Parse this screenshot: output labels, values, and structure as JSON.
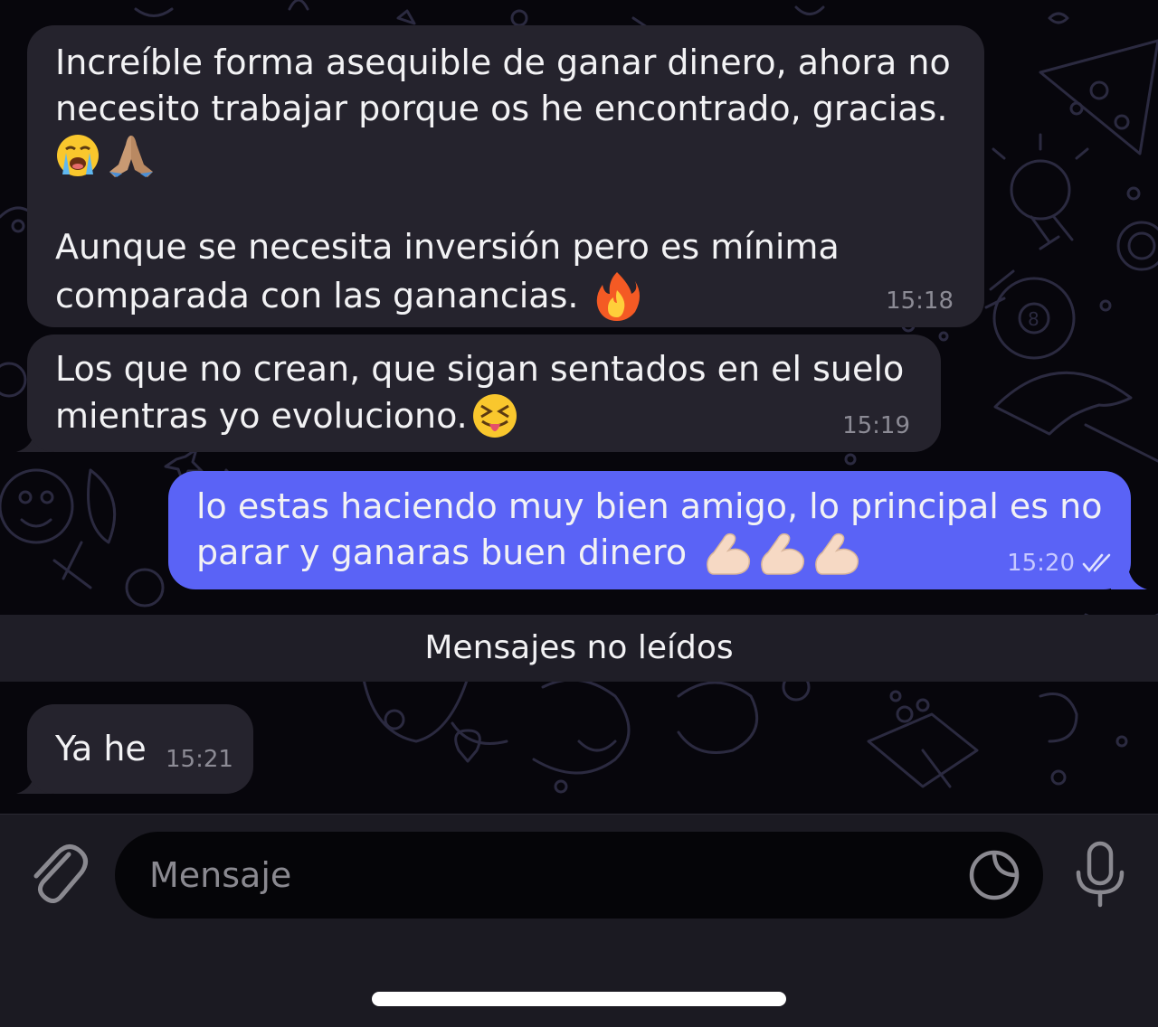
{
  "colors": {
    "background": "#07060c",
    "incoming_bubble": "#25232d",
    "outgoing_bubble": "#5a63f6",
    "input_bar": "#1b1a22",
    "unread_bar": "#1f1e27"
  },
  "messages": [
    {
      "direction": "incoming",
      "lines": [
        "Increíble forma asequible de ganar dinero, ahora no",
        "necesito trabajar porque os he encontrado, gracias."
      ],
      "emojis_1": [
        "loudly-crying-face-emoji",
        "folded-hands-emoji"
      ],
      "lines_2": [
        "Aunque se necesita inversión pero es mínima",
        "comparada con las ganancias."
      ],
      "emojis_2": [
        "fire-emoji"
      ],
      "time": "15:18"
    },
    {
      "direction": "incoming",
      "lines": [
        "Los que no crean, que sigan sentados en el suelo",
        "mientras yo evoluciono."
      ],
      "emojis": [
        "squinting-face-with-tongue-emoji"
      ],
      "time": "15:19"
    },
    {
      "direction": "outgoing",
      "lines": [
        "lo estas haciendo muy bien amigo, lo principal es no",
        "parar y ganaras buen dinero"
      ],
      "emojis": [
        "flexed-biceps-emoji",
        "flexed-biceps-emoji",
        "flexed-biceps-emoji"
      ],
      "time": "15:20",
      "status": "read-double-check-icon"
    },
    {
      "direction": "incoming",
      "lines": [
        "Ya he"
      ],
      "time": "15:21"
    }
  ],
  "unread_divider": {
    "label": "Mensajes no leídos"
  },
  "composer": {
    "placeholder": "Mensaje",
    "attach_icon": "paperclip-icon",
    "sticker_icon": "sticker-icon",
    "mic_icon": "microphone-icon"
  }
}
